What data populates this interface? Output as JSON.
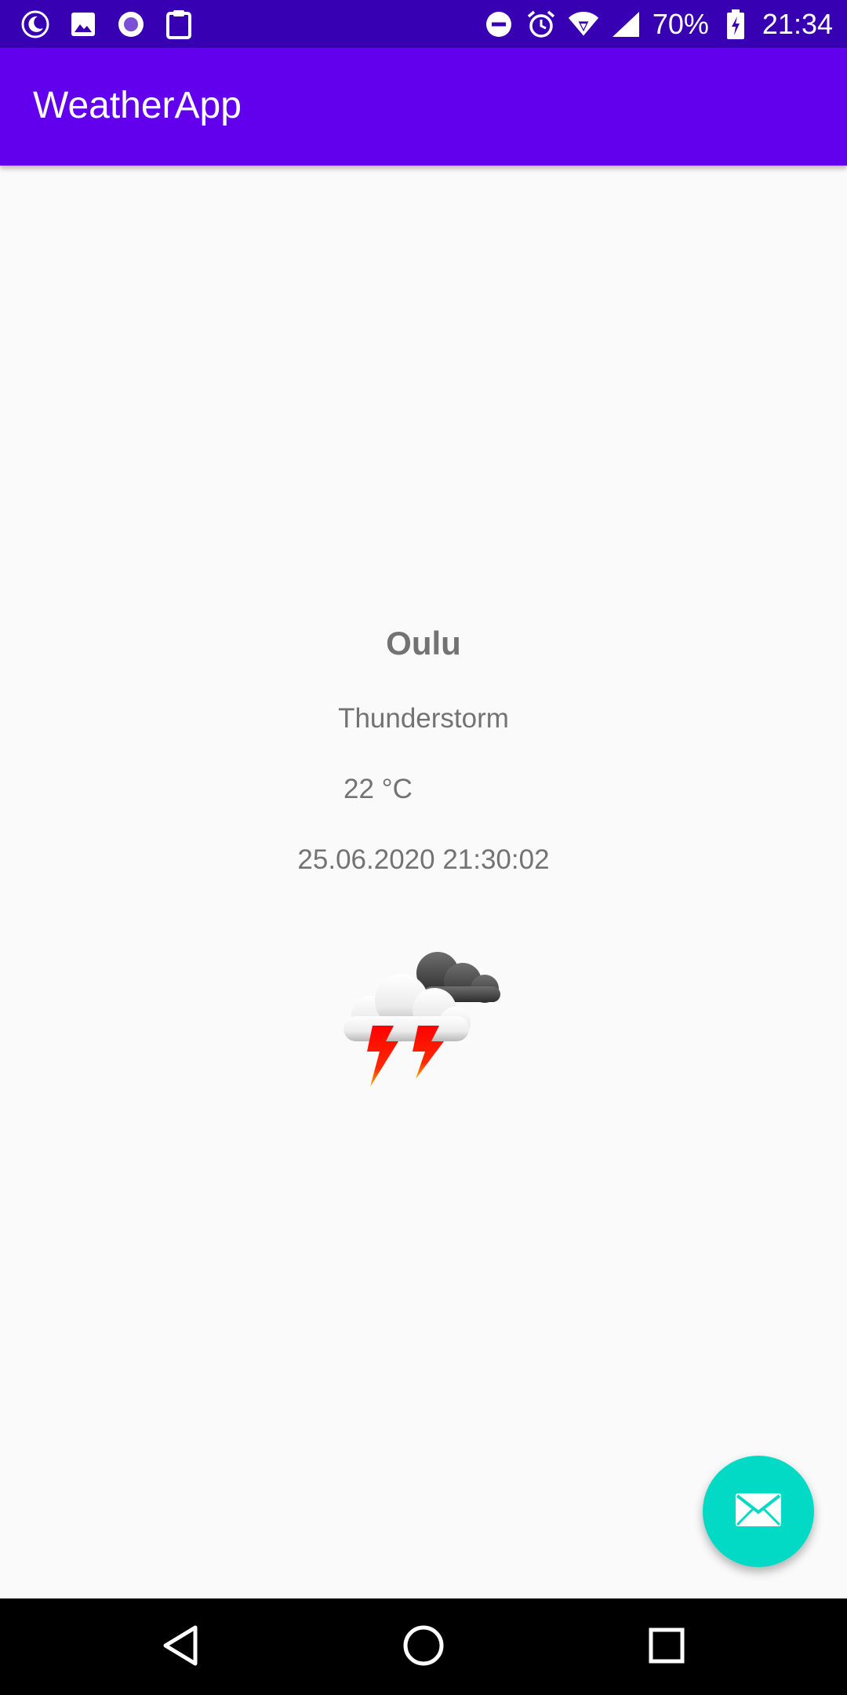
{
  "status_bar": {
    "battery_percent": "70%",
    "time": "21:34",
    "left_icons": [
      "moon-icon",
      "image-icon",
      "circle-dot-icon",
      "clipboard-icon"
    ],
    "right_icons": [
      "do-not-disturb-icon",
      "alarm-icon",
      "wifi-icon",
      "signal-icon",
      "battery-charging-icon"
    ]
  },
  "app_bar": {
    "title": "WeatherApp"
  },
  "weather": {
    "city": "Oulu",
    "condition": "Thunderstorm",
    "temperature": "22 °C",
    "updated": "25.06.2020 21:30:02",
    "icon": "thunderstorm-icon"
  },
  "fab": {
    "icon": "mail-icon"
  },
  "nav_bar": {
    "buttons": [
      "back-icon",
      "home-icon",
      "recents-icon"
    ]
  },
  "colors": {
    "status_bar": "#3700b3",
    "app_bar": "#6200ee",
    "fab": "#03dac5",
    "background": "#fafafa",
    "text": "#737373"
  }
}
